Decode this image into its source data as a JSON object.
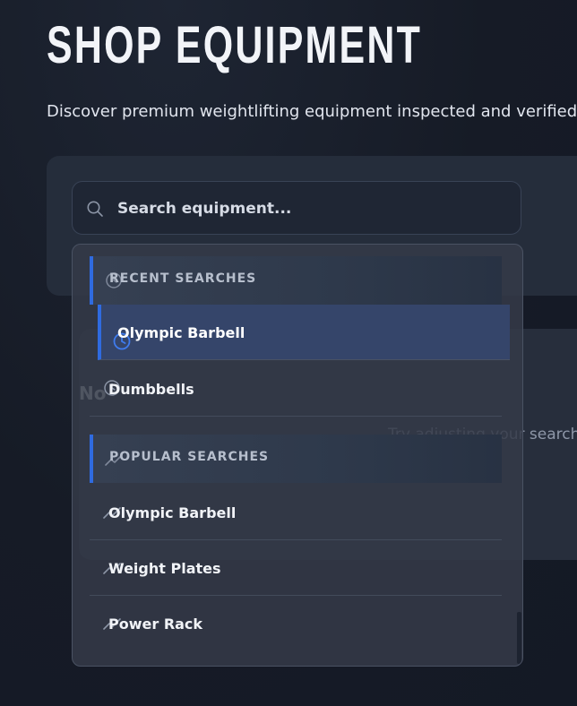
{
  "header": {
    "title": "SHOP EQUIPMENT",
    "subtitle": "Discover premium weightlifting equipment inspected and verified b"
  },
  "search": {
    "placeholder": "Search equipment...",
    "value": "",
    "icon": "search-icon"
  },
  "dropdown": {
    "recent": {
      "label": "RECENT SEARCHES",
      "icon": "clock-icon",
      "items": [
        {
          "label": "Olympic Barbell",
          "icon": "clock-icon",
          "active": true
        },
        {
          "label": "Dumbbells",
          "icon": "clock-icon",
          "active": false
        }
      ]
    },
    "popular": {
      "label": "POPULAR SEARCHES",
      "icon": "trending-icon",
      "items": [
        {
          "label": "Olympic Barbell",
          "icon": "trending-icon"
        },
        {
          "label": "Weight Plates",
          "icon": "trending-icon"
        },
        {
          "label": "Power Rack",
          "icon": "trending-icon"
        }
      ]
    }
  },
  "empty_state": {
    "title": "No",
    "text": "Try adjusting your search to"
  },
  "colors": {
    "accent": "#2f6be0",
    "background": "#161b26",
    "panel": "#252d3b"
  }
}
